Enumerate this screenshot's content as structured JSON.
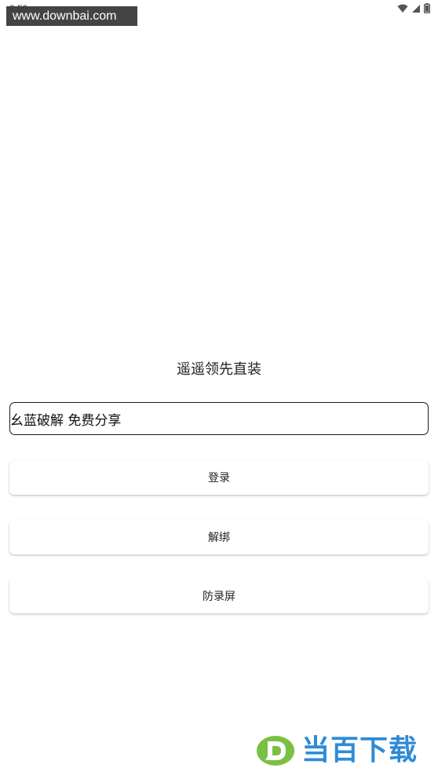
{
  "status_bar": {
    "time": "9:59",
    "icons": [
      "wifi-icon",
      "signal-icon",
      "battery-icon"
    ]
  },
  "watermark": {
    "text": "www.downbai.com"
  },
  "title": "遥遥领先直装",
  "card_input": {
    "value": "幺蓝破解 免费分享"
  },
  "buttons": {
    "login": "登录",
    "unbind": "解绑",
    "anti_record": "防录屏"
  },
  "brand": {
    "text": "当百下载",
    "color": "#2f8bd6",
    "accent": "#7ac143"
  }
}
